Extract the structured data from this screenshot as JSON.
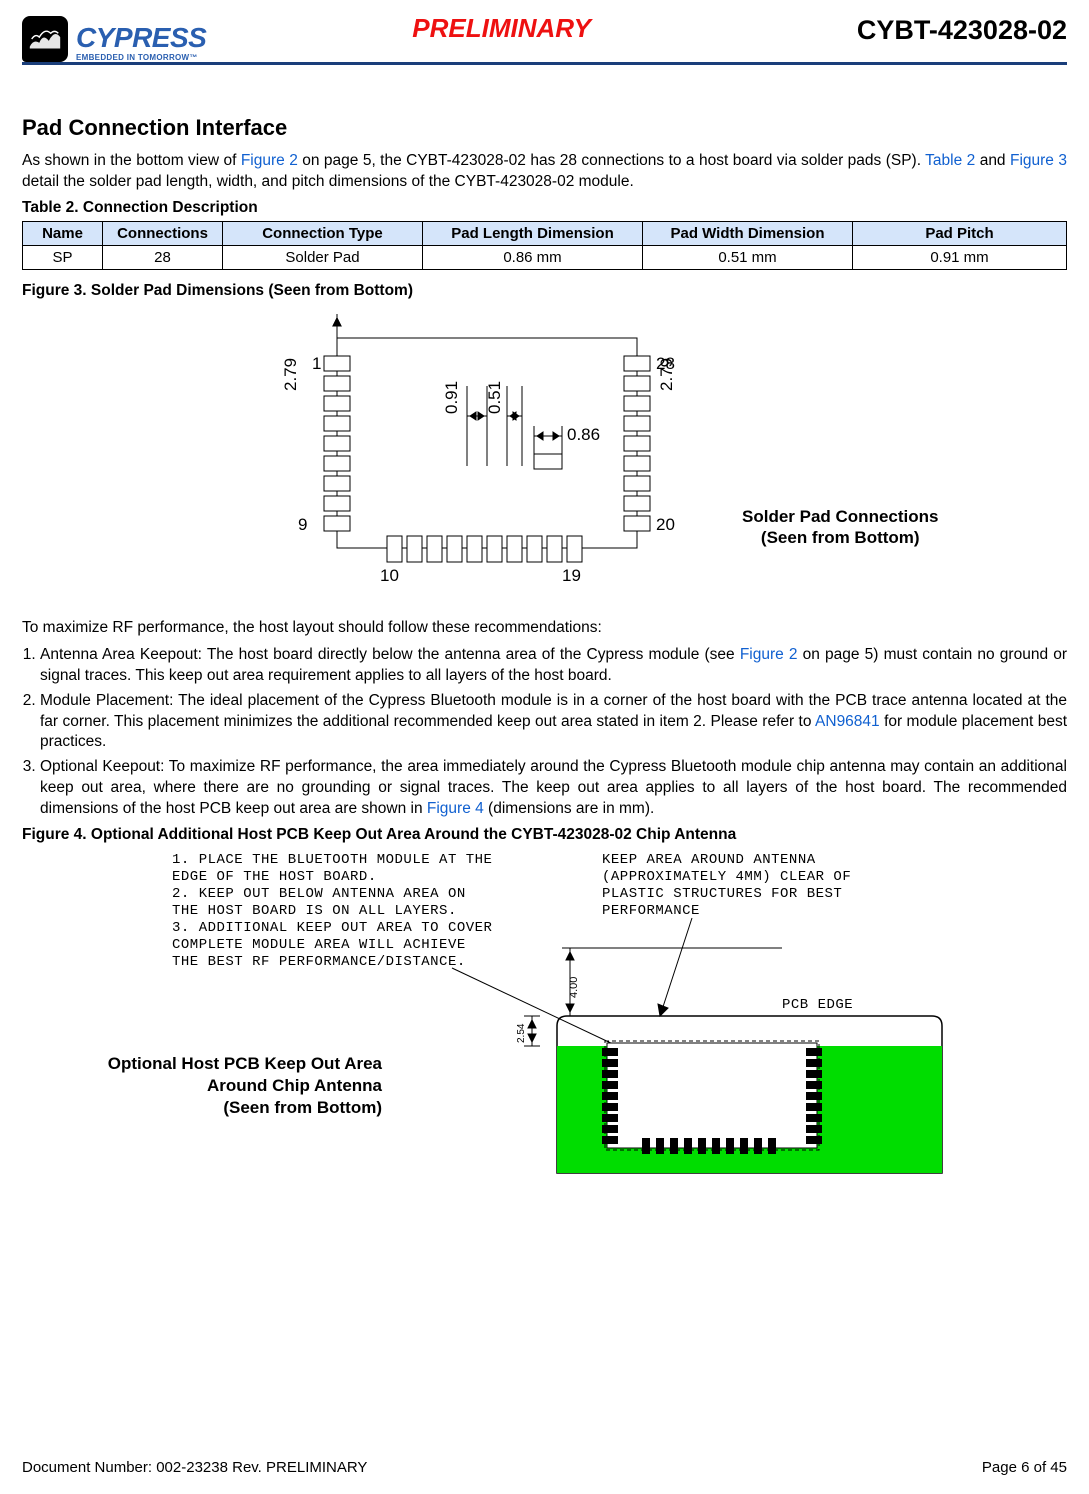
{
  "header": {
    "brand_main": "CYPRESS",
    "brand_tag": "EMBEDDED IN TOMORROW™",
    "preliminary": "PRELIMINARY",
    "doc_code": "CYBT-423028-02"
  },
  "section_title": "Pad Connection Interface",
  "intro_1a": "As shown in the bottom view of ",
  "intro_1_link1": "Figure 2",
  "intro_1b": " on page 5, the CYBT-423028-02 has 28 connections to a host board via solder pads (SP). ",
  "intro_1_link2": "Table 2",
  "intro_1c": " and ",
  "intro_1_link3": "Figure 3",
  "intro_1d": " detail the solder pad length, width, and pitch dimensions of the CYBT-423028-02 module.",
  "table2_caption": "Table 2.  Connection Description",
  "table2": {
    "headers": [
      "Name",
      "Connections",
      "Connection Type",
      "Pad Length Dimension",
      "Pad Width Dimension",
      "Pad Pitch"
    ],
    "row": [
      "SP",
      "28",
      "Solder Pad",
      "0.86 mm",
      "0.51 mm",
      "0.91 mm"
    ]
  },
  "fig3_caption": "Figure 3.  Solder Pad Dimensions (Seen from Bottom)",
  "fig3": {
    "dims": {
      "d279a": "2.79",
      "d279b": "2.79",
      "d091": "0.91",
      "d051": "0.51",
      "d086": "0.86"
    },
    "pins": {
      "p1": "1",
      "p9": "9",
      "p10": "10",
      "p19": "19",
      "p20": "20",
      "p28": "28"
    },
    "label_l1": "Solder Pad Connections",
    "label_l2": "(Seen from Bottom)"
  },
  "rec_intro": "To maximize RF performance, the host layout should follow these recommendations:",
  "rec1a": "Antenna Area Keepout: The host board directly below the antenna area of the Cypress module (see ",
  "rec1_link": "Figure 2",
  "rec1b": " on page 5) must contain no ground or signal traces. This keep out area requirement applies to all layers of the host board.",
  "rec2a": "Module Placement: The ideal placement of the Cypress Bluetooth module is in a corner of the host board with the PCB trace antenna located at the far corner. This placement minimizes the additional recommended keep out area stated in item 2. Please refer to ",
  "rec2_link": "AN96841",
  "rec2b": " for module placement best practices.",
  "rec3a": "Optional Keepout: To maximize RF performance, the area immediately around the Cypress Bluetooth module chip antenna may contain an additional keep out area, where there are no grounding or signal traces. The keep out area applies to all layers of the host board. The recommended dimensions of the host PCB keep out area are shown in ",
  "rec3_link": "Figure 4",
  "rec3b": " (dimensions are in mm).",
  "fig4_caption": "Figure 4.  Optional Additional Host PCB Keep Out Area Around the CYBT-423028-02 Chip Antenna",
  "fig4": {
    "notes_l1": "1. PLACE THE BLUETOOTH MODULE AT THE",
    "notes_l2": "EDGE OF THE HOST BOARD.",
    "notes_l3": "2. KEEP OUT BELOW ANTENNA AREA ON",
    "notes_l4": "THE HOST BOARD IS ON ALL LAYERS.",
    "notes_l5": "3. ADDITIONAL KEEP OUT AREA TO COVER",
    "notes_l6": "COMPLETE MODULE AREA WILL ACHIEVE",
    "notes_l7": "THE BEST RF PERFORMANCE/DISTANCE.",
    "keep_l1": "KEEP AREA AROUND ANTENNA",
    "keep_l2": "(APPROXIMATELY 4MM) CLEAR OF",
    "keep_l3": "PLASTIC STRUCTURES FOR BEST",
    "keep_l4": "PERFORMANCE",
    "pcb_edge": "PCB EDGE",
    "d400": "4.00",
    "d254": "2.54",
    "label_l1": "Optional Host PCB Keep Out Area",
    "label_l2": "Around Chip Antenna",
    "label_l3": "(Seen from Bottom)"
  },
  "footer": {
    "left": "Document Number: 002-23238 Rev. PRELIMINARY",
    "right": "Page 6 of 45"
  },
  "chart_data": {
    "type": "table",
    "title": "Table 2. Connection Description",
    "columns": [
      "Name",
      "Connections",
      "Connection Type",
      "Pad Length Dimension",
      "Pad Width Dimension",
      "Pad Pitch"
    ],
    "rows": [
      [
        "SP",
        28,
        "Solder Pad",
        "0.86 mm",
        "0.51 mm",
        "0.91 mm"
      ]
    ]
  }
}
